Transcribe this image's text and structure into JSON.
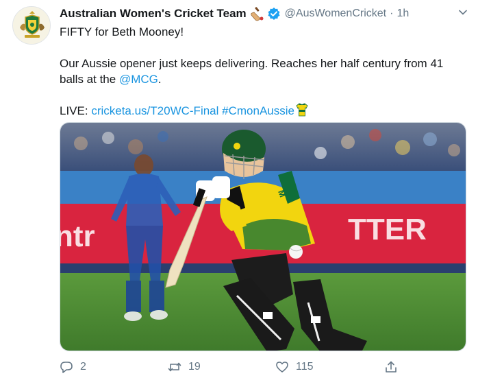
{
  "author": {
    "display_name": "Australian Women's Cricket Team",
    "handle": "@AusWomenCricket",
    "separator": "·",
    "time": "1h",
    "avatar_icon": "australia-cricket-crest-icon",
    "badge_icon": "cricket-bat-icon",
    "verified_icon": "verified-badge-icon"
  },
  "tweet": {
    "line1": "FIFTY for Beth Mooney!",
    "line2a": "Our Aussie opener just keeps delivering. Reaches her half century from 41",
    "line2b": "balls at the ",
    "mention": "@MCG",
    "line2c": ".",
    "live_prefix": "LIVE: ",
    "live_link": "cricketa.us/T20WC-Final",
    "hashtag": "#CmonAussie",
    "emoji_icon": "green-gold-jersey-icon"
  },
  "media": {
    "kind": "photo",
    "subject": "batter-in-green-gold-kit-playing-a-shot"
  },
  "actions": {
    "reply_count": "2",
    "retweet_count": "19",
    "like_count": "115",
    "icons": [
      "reply-icon",
      "retweet-icon",
      "like-icon",
      "share-icon"
    ]
  },
  "colors": {
    "link": "#1b95e0",
    "muted": "#657786",
    "verified": "#1da1f2",
    "jersey_yellow": "#f2d50f",
    "jersey_green": "#0f6e3a"
  }
}
